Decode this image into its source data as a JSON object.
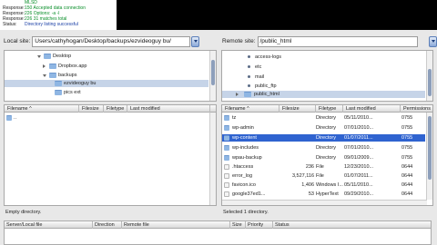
{
  "message_log": [
    {
      "label": "",
      "text": "MLSD",
      "color": "green"
    },
    {
      "label": "Response:",
      "text": "150 Accepted data connection",
      "color": "green"
    },
    {
      "label": "Response:",
      "text": "226 Options: -a -l",
      "color": "green"
    },
    {
      "label": "Response:",
      "text": "226 31 matches total",
      "color": "green"
    },
    {
      "label": "Status:",
      "text": "Directory listing successful",
      "color": "blue"
    }
  ],
  "local": {
    "label": "Local site:",
    "path": "Users/cathyhogan/Desktop/backups/ezvideoguy bu/",
    "tree": [
      {
        "name": "Desktop",
        "icon": "folder",
        "expander": "down"
      },
      {
        "name": "Dropbox.app",
        "icon": "folder",
        "expander": "right"
      },
      {
        "name": "backups",
        "icon": "folder",
        "expander": "down"
      },
      {
        "name": "ezvideoguy bu",
        "icon": "folder",
        "expander": "",
        "selected": true
      },
      {
        "name": "pics ext",
        "icon": "folder",
        "expander": ""
      }
    ],
    "columns": [
      "Filename",
      "Filesize",
      "Filetype",
      "Last modified"
    ],
    "files": [
      {
        "name": "..",
        "size": "",
        "type": "",
        "modified": ""
      }
    ],
    "status": "Empty directory."
  },
  "remote": {
    "label": "Remote site:",
    "path": "/public_html",
    "tree": [
      {
        "name": "access-logs",
        "icon": "dot"
      },
      {
        "name": "etc",
        "icon": "dot"
      },
      {
        "name": "mail",
        "icon": "dot"
      },
      {
        "name": "public_ftp",
        "icon": "dot"
      },
      {
        "name": "public_html",
        "icon": "folder",
        "selected": true
      }
    ],
    "columns": [
      "Filename",
      "Filesize",
      "Filetype",
      "Last modified",
      "Permissions"
    ],
    "files": [
      {
        "name": "tz",
        "size": "",
        "type": "Directory",
        "modified": "05/11/2010...",
        "perm": "0755",
        "icon": "folder"
      },
      {
        "name": "wp-admin",
        "size": "",
        "type": "Directory",
        "modified": "07/01/2010...",
        "perm": "0755",
        "icon": "folder"
      },
      {
        "name": "wp-content",
        "size": "",
        "type": "Directory",
        "modified": "01/07/2011...",
        "perm": "0755",
        "icon": "folder",
        "selected": true
      },
      {
        "name": "wp-includes",
        "size": "",
        "type": "Directory",
        "modified": "07/01/2010...",
        "perm": "0755",
        "icon": "folder"
      },
      {
        "name": "wpau-backup",
        "size": "",
        "type": "Directory",
        "modified": "09/01/2009...",
        "perm": "0755",
        "icon": "folder"
      },
      {
        "name": ".htaccess",
        "size": "236",
        "type": "File",
        "modified": "12/23/2010...",
        "perm": "0644",
        "icon": "file"
      },
      {
        "name": "error_log",
        "size": "3,527,116",
        "type": "File",
        "modified": "01/07/2011...",
        "perm": "0644",
        "icon": "file"
      },
      {
        "name": "favicon.ico",
        "size": "1,406",
        "type": "Windows I...",
        "modified": "05/11/2010...",
        "perm": "0644",
        "icon": "file"
      },
      {
        "name": "google37ed1...",
        "size": "53",
        "type": "HyperText",
        "modified": "09/29/2010...",
        "perm": "0644",
        "icon": "file"
      }
    ],
    "status": "Selected 1 directory."
  },
  "queue_columns": [
    "Server/Local file",
    "Direction",
    "Remote file",
    "Size",
    "Priority",
    "Status"
  ]
}
